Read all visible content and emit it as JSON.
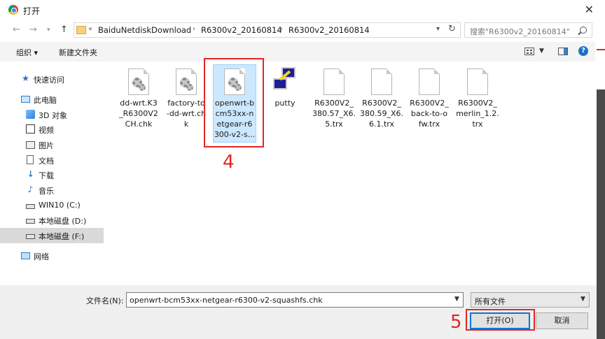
{
  "window": {
    "title": "打开"
  },
  "nav": {
    "back_icon": "arrow-left-icon",
    "forward_icon": "arrow-right-icon",
    "recent_icon": "chevron-down-icon",
    "up_icon": "arrow-up-icon",
    "breadcrumb": {
      "overflow": "«",
      "items": [
        "BaiduNetdiskDownload",
        "R6300v2_20160814",
        "R6300v2_20160814"
      ],
      "separator": "›"
    },
    "search_placeholder": "搜索\"R6300v2_20160814\""
  },
  "toolbar": {
    "organize": "组织 ▾",
    "new_folder": "新建文件夹",
    "help": "?"
  },
  "sidebar": {
    "items": [
      {
        "label": "快速访问",
        "icon": "star-icon"
      },
      {
        "label": "此电脑",
        "icon": "computer-icon"
      },
      {
        "label": "3D 对象",
        "icon": "3d-objects-icon"
      },
      {
        "label": "视频",
        "icon": "video-icon"
      },
      {
        "label": "图片",
        "icon": "pictures-icon"
      },
      {
        "label": "文档",
        "icon": "document-icon"
      },
      {
        "label": "下载",
        "icon": "download-icon"
      },
      {
        "label": "音乐",
        "icon": "music-icon"
      },
      {
        "label": "WIN10 (C:)",
        "icon": "drive-icon"
      },
      {
        "label": "本地磁盘 (D:)",
        "icon": "drive-icon"
      },
      {
        "label": "本地磁盘 (F:)",
        "icon": "drive-icon",
        "selected": true
      },
      {
        "label": "网络",
        "icon": "network-icon"
      }
    ]
  },
  "files": [
    {
      "name": "dd-wrt.K3_R6300V2CH.chk",
      "label": "dd-wrt.K3\n_R6300V2\nCH.chk",
      "icon": "settings-file-icon"
    },
    {
      "name": "factory-to-dd-wrt.chk",
      "label": "factory-to\n-dd-wrt.ch\nk",
      "icon": "settings-file-icon"
    },
    {
      "name": "openwrt-bcm53xx-netgear-r6300-v2-squashfs.chk",
      "label": "openwrt-b\ncm53xx-n\netgear-r6\n300-v2-s...",
      "icon": "settings-file-icon",
      "selected": true
    },
    {
      "name": "putty",
      "label": "putty",
      "icon": "putty-icon"
    },
    {
      "name": "R6300V2_380.57_X6.5.trx",
      "label": "R6300V2_\n380.57_X6.\n5.trx",
      "icon": "blank-file-icon"
    },
    {
      "name": "R6300V2_380.59_X6.6.1.trx",
      "label": "R6300V2_\n380.59_X6.\n6.1.trx",
      "icon": "blank-file-icon"
    },
    {
      "name": "R6300V2_back-to-ofw.trx",
      "label": "R6300V2_\nback-to-o\nfw.trx",
      "icon": "blank-file-icon"
    },
    {
      "name": "R6300V2_merlin_1.2.trx",
      "label": "R6300V2_\nmerlin_1.2.\ntrx",
      "icon": "blank-file-icon"
    }
  ],
  "annotations": {
    "step4": "4",
    "step5": "5",
    "color": "#e32626"
  },
  "bottom": {
    "filename_label": "文件名(N):",
    "filename_value": "openwrt-bcm53xx-netgear-r6300-v2-squashfs.chk",
    "filetype_value": "所有文件",
    "open_button": "打开(O)",
    "cancel_button": "取消"
  }
}
